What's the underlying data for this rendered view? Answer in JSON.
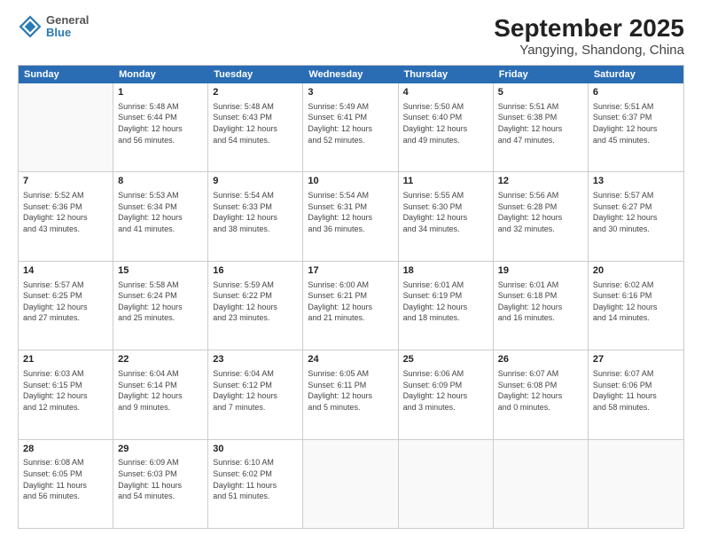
{
  "title": "September 2025",
  "subtitle": "Yangying, Shandong, China",
  "logo": {
    "line1": "General",
    "line2": "Blue"
  },
  "days_of_week": [
    "Sunday",
    "Monday",
    "Tuesday",
    "Wednesday",
    "Thursday",
    "Friday",
    "Saturday"
  ],
  "weeks": [
    [
      {
        "day": "",
        "info": ""
      },
      {
        "day": "1",
        "info": "Sunrise: 5:48 AM\nSunset: 6:44 PM\nDaylight: 12 hours\nand 56 minutes."
      },
      {
        "day": "2",
        "info": "Sunrise: 5:48 AM\nSunset: 6:43 PM\nDaylight: 12 hours\nand 54 minutes."
      },
      {
        "day": "3",
        "info": "Sunrise: 5:49 AM\nSunset: 6:41 PM\nDaylight: 12 hours\nand 52 minutes."
      },
      {
        "day": "4",
        "info": "Sunrise: 5:50 AM\nSunset: 6:40 PM\nDaylight: 12 hours\nand 49 minutes."
      },
      {
        "day": "5",
        "info": "Sunrise: 5:51 AM\nSunset: 6:38 PM\nDaylight: 12 hours\nand 47 minutes."
      },
      {
        "day": "6",
        "info": "Sunrise: 5:51 AM\nSunset: 6:37 PM\nDaylight: 12 hours\nand 45 minutes."
      }
    ],
    [
      {
        "day": "7",
        "info": "Sunrise: 5:52 AM\nSunset: 6:36 PM\nDaylight: 12 hours\nand 43 minutes."
      },
      {
        "day": "8",
        "info": "Sunrise: 5:53 AM\nSunset: 6:34 PM\nDaylight: 12 hours\nand 41 minutes."
      },
      {
        "day": "9",
        "info": "Sunrise: 5:54 AM\nSunset: 6:33 PM\nDaylight: 12 hours\nand 38 minutes."
      },
      {
        "day": "10",
        "info": "Sunrise: 5:54 AM\nSunset: 6:31 PM\nDaylight: 12 hours\nand 36 minutes."
      },
      {
        "day": "11",
        "info": "Sunrise: 5:55 AM\nSunset: 6:30 PM\nDaylight: 12 hours\nand 34 minutes."
      },
      {
        "day": "12",
        "info": "Sunrise: 5:56 AM\nSunset: 6:28 PM\nDaylight: 12 hours\nand 32 minutes."
      },
      {
        "day": "13",
        "info": "Sunrise: 5:57 AM\nSunset: 6:27 PM\nDaylight: 12 hours\nand 30 minutes."
      }
    ],
    [
      {
        "day": "14",
        "info": "Sunrise: 5:57 AM\nSunset: 6:25 PM\nDaylight: 12 hours\nand 27 minutes."
      },
      {
        "day": "15",
        "info": "Sunrise: 5:58 AM\nSunset: 6:24 PM\nDaylight: 12 hours\nand 25 minutes."
      },
      {
        "day": "16",
        "info": "Sunrise: 5:59 AM\nSunset: 6:22 PM\nDaylight: 12 hours\nand 23 minutes."
      },
      {
        "day": "17",
        "info": "Sunrise: 6:00 AM\nSunset: 6:21 PM\nDaylight: 12 hours\nand 21 minutes."
      },
      {
        "day": "18",
        "info": "Sunrise: 6:01 AM\nSunset: 6:19 PM\nDaylight: 12 hours\nand 18 minutes."
      },
      {
        "day": "19",
        "info": "Sunrise: 6:01 AM\nSunset: 6:18 PM\nDaylight: 12 hours\nand 16 minutes."
      },
      {
        "day": "20",
        "info": "Sunrise: 6:02 AM\nSunset: 6:16 PM\nDaylight: 12 hours\nand 14 minutes."
      }
    ],
    [
      {
        "day": "21",
        "info": "Sunrise: 6:03 AM\nSunset: 6:15 PM\nDaylight: 12 hours\nand 12 minutes."
      },
      {
        "day": "22",
        "info": "Sunrise: 6:04 AM\nSunset: 6:14 PM\nDaylight: 12 hours\nand 9 minutes."
      },
      {
        "day": "23",
        "info": "Sunrise: 6:04 AM\nSunset: 6:12 PM\nDaylight: 12 hours\nand 7 minutes."
      },
      {
        "day": "24",
        "info": "Sunrise: 6:05 AM\nSunset: 6:11 PM\nDaylight: 12 hours\nand 5 minutes."
      },
      {
        "day": "25",
        "info": "Sunrise: 6:06 AM\nSunset: 6:09 PM\nDaylight: 12 hours\nand 3 minutes."
      },
      {
        "day": "26",
        "info": "Sunrise: 6:07 AM\nSunset: 6:08 PM\nDaylight: 12 hours\nand 0 minutes."
      },
      {
        "day": "27",
        "info": "Sunrise: 6:07 AM\nSunset: 6:06 PM\nDaylight: 11 hours\nand 58 minutes."
      }
    ],
    [
      {
        "day": "28",
        "info": "Sunrise: 6:08 AM\nSunset: 6:05 PM\nDaylight: 11 hours\nand 56 minutes."
      },
      {
        "day": "29",
        "info": "Sunrise: 6:09 AM\nSunset: 6:03 PM\nDaylight: 11 hours\nand 54 minutes."
      },
      {
        "day": "30",
        "info": "Sunrise: 6:10 AM\nSunset: 6:02 PM\nDaylight: 11 hours\nand 51 minutes."
      },
      {
        "day": "",
        "info": ""
      },
      {
        "day": "",
        "info": ""
      },
      {
        "day": "",
        "info": ""
      },
      {
        "day": "",
        "info": ""
      }
    ]
  ]
}
